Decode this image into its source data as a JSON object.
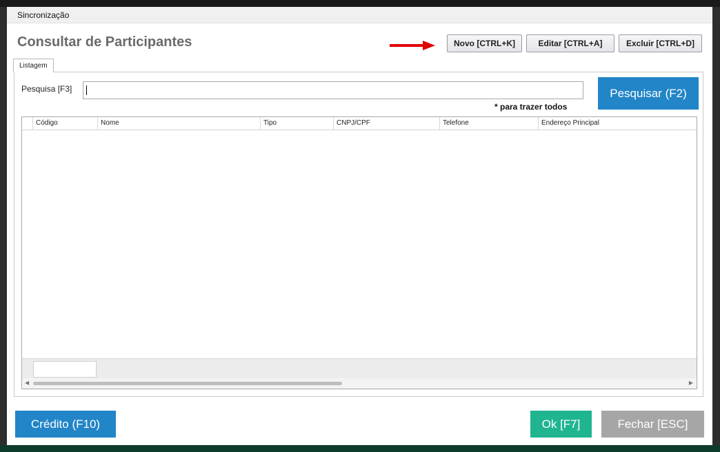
{
  "window": {
    "title": "Sincronização"
  },
  "page_title": "Consultar de Participantes",
  "toolbar": {
    "new_label": "Novo [CTRL+K]",
    "edit_label": "Editar [CTRL+A]",
    "delete_label": "Excluir [CTRL+D]"
  },
  "tabs": {
    "listing_label": "Listagem"
  },
  "search": {
    "label": "Pesquisa [F3]",
    "value": "",
    "hint": "* para trazer todos",
    "button_label": "Pesquisar (F2)"
  },
  "table": {
    "columns": [
      "Código",
      "Nome",
      "Tipo",
      "CNPJ/CPF",
      "Telefone",
      "Endereço Principal"
    ],
    "rows": []
  },
  "footer": {
    "credit_label": "Crédito (F10)",
    "ok_label": "Ok [F7]",
    "close_label": "Fechar [ESC]"
  },
  "colors": {
    "primary": "#2185c8",
    "ok": "#1fb58f",
    "close": "#a6a6a6",
    "arrow": "#e00000"
  }
}
